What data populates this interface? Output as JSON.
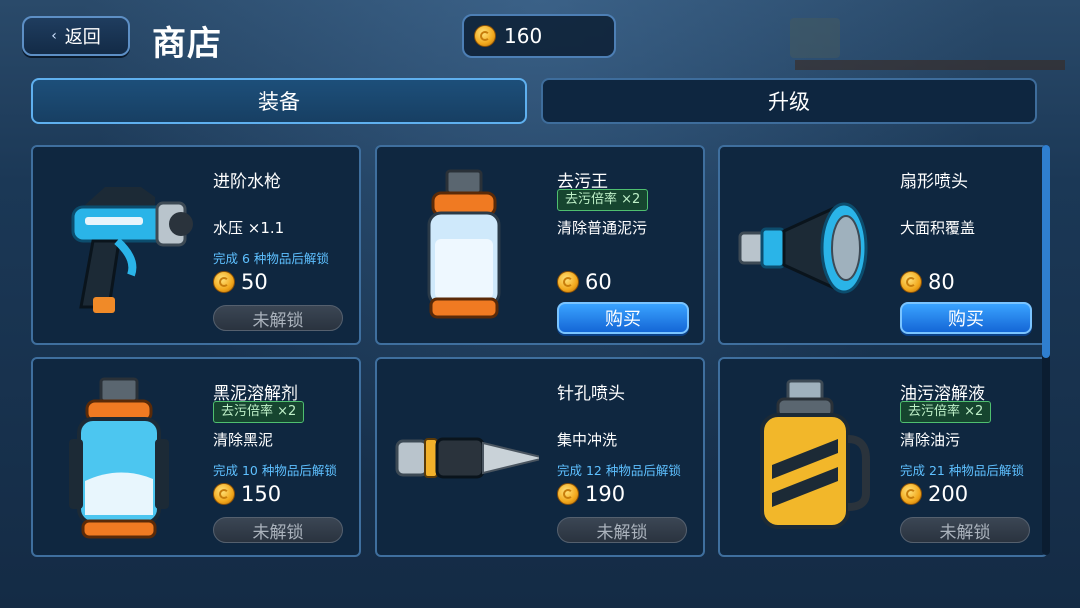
{
  "header": {
    "back_label": "返回",
    "title": "商店",
    "coins": "160"
  },
  "tabs": [
    {
      "label": "装备",
      "active": true
    },
    {
      "label": "升级",
      "active": false
    }
  ],
  "items": [
    {
      "name": "进阶水枪",
      "badge": "",
      "desc": "水压 ×1.1",
      "unlock_text": "完成 6 种物品后解锁",
      "price": "50",
      "button": "未解锁",
      "locked": true,
      "icon": "water-gun-icon"
    },
    {
      "name": "去污王",
      "badge": "去污倍率 ×2",
      "desc": "清除普通泥污",
      "unlock_text": "",
      "price": "60",
      "button": "购买",
      "locked": false,
      "icon": "detergent-bottle-icon"
    },
    {
      "name": "扇形喷头",
      "badge": "",
      "desc": "大面积覆盖",
      "unlock_text": "",
      "price": "80",
      "button": "购买",
      "locked": false,
      "icon": "fan-nozzle-icon"
    },
    {
      "name": "黑泥溶解剂",
      "badge": "去污倍率 ×2",
      "desc": "清除黑泥",
      "unlock_text": "完成 10 种物品后解锁",
      "price": "150",
      "button": "未解锁",
      "locked": true,
      "icon": "mud-dissolver-icon"
    },
    {
      "name": "针孔喷头",
      "badge": "",
      "desc": "集中冲洗",
      "unlock_text": "完成 12 种物品后解锁",
      "price": "190",
      "button": "未解锁",
      "locked": true,
      "icon": "pinhole-nozzle-icon"
    },
    {
      "name": "油污溶解液",
      "badge": "去污倍率 ×2",
      "desc": "清除油污",
      "unlock_text": "完成 21 种物品后解锁",
      "price": "200",
      "button": "未解锁",
      "locked": true,
      "icon": "oil-dissolver-icon"
    }
  ],
  "colors": {
    "accent": "#2f7fd0",
    "badge_green": "#4fbf6f",
    "unlock_blue": "#5ec0ff"
  },
  "scroll": {
    "visible_fraction": 0.52
  }
}
